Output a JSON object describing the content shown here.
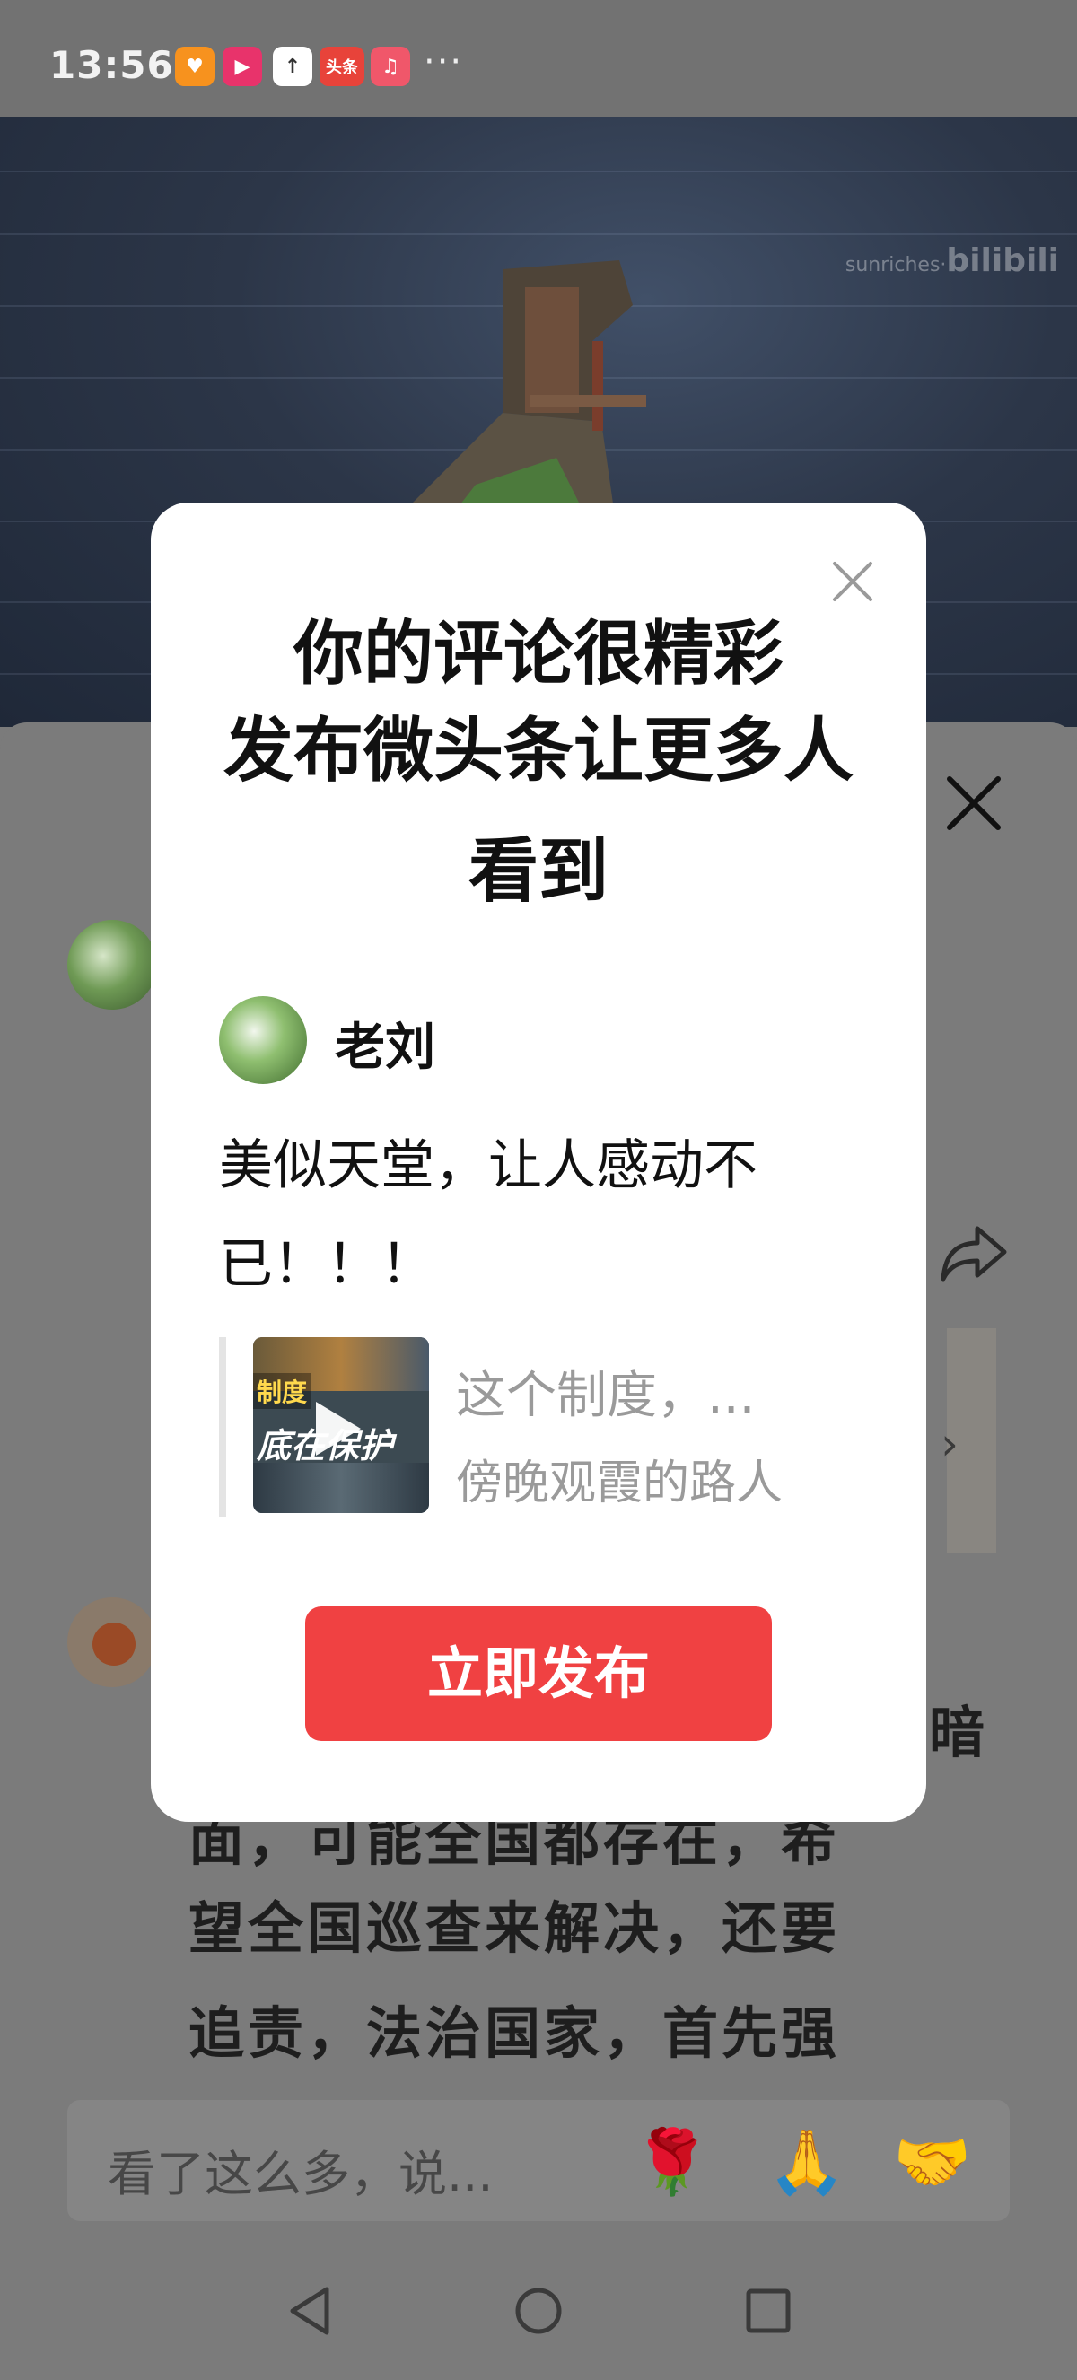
{
  "status_bar": {
    "time": "13:56",
    "app_icons": [
      {
        "name": "heart-app-icon",
        "color": "#f7921e"
      },
      {
        "name": "video-app-icon",
        "color": "#e8336b"
      },
      {
        "name": "upload-app-icon",
        "color": "#ffffff"
      },
      {
        "name": "toutiao-app-icon",
        "label": "头条",
        "color": "#e8433a"
      },
      {
        "name": "music-app-icon",
        "color": "#f0576a"
      }
    ],
    "more": "···"
  },
  "video": {
    "watermark_user": "sunriches·",
    "watermark_brand": "bilibili"
  },
  "dialog": {
    "title_line1": "你的评论很精彩",
    "title_line2": "发布微头条让更多人",
    "title_line3": "看到",
    "username": "老刘",
    "comment_line1": "美似天堂，让人感动不",
    "comment_line2": "已！！！",
    "quote": {
      "thumb_tag": "制度",
      "thumb_caption": "底在保护",
      "text": "这个制度，...",
      "author": "傍晚观霞的路人"
    },
    "publish_label": "立即发布"
  },
  "background": {
    "comment_text_lines": [
      "暗",
      "面，可能全国都存在，希",
      "望全国巡查来解决，还要",
      "追责，法治国家，首先强"
    ],
    "input_placeholder": "看了这么多，说...",
    "emojis": [
      "🌹",
      "🙏",
      "🤝"
    ]
  },
  "colors": {
    "accent_red": "#f04142",
    "overlay_gray": "#7b7b7b"
  }
}
